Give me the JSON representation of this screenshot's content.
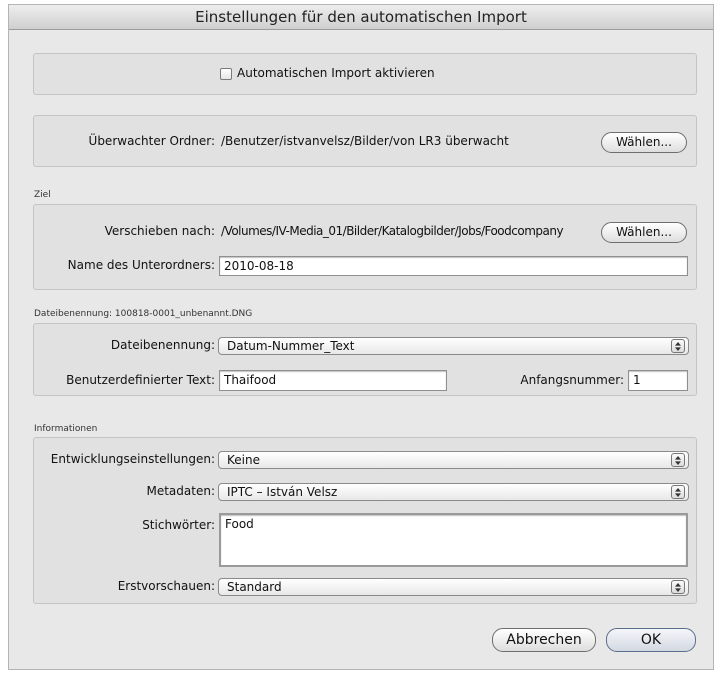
{
  "window": {
    "title": "Einstellungen für den automatischen Import"
  },
  "auto_import": {
    "label": "Automatischen Import aktivieren",
    "checked": false
  },
  "watched": {
    "label": "Überwachter Ordner:",
    "path": "/Benutzer/istvanvelsz/Bilder/von LR3 überwacht",
    "button": "Wählen..."
  },
  "destination": {
    "section": "Ziel",
    "move_label": "Verschieben nach:",
    "move_path": "/Volumes/IV-Media_01/Bilder/Katalogbilder/Jobs/Foodcompany",
    "button": "Wählen...",
    "subfolder_label": "Name des Unterordners:",
    "subfolder_value": "2010-08-18"
  },
  "naming": {
    "section": "Dateibenennung: 100818-0001_unbenannt.DNG",
    "label": "Dateibenennung:",
    "value": "Datum-Nummer_Text",
    "custom_label": "Benutzerdefinierter Text:",
    "custom_value": "Thaifood",
    "start_label": "Anfangsnummer:",
    "start_value": "1"
  },
  "info": {
    "section": "Informationen",
    "develop_label": "Entwicklungseinstellungen:",
    "develop_value": "Keine",
    "meta_label": "Metadaten:",
    "meta_value": "IPTC – István Velsz",
    "keywords_label": "Stichwörter:",
    "keywords_value": "Food",
    "preview_label": "Erstvorschauen:",
    "preview_value": "Standard"
  },
  "footer": {
    "cancel": "Abbrechen",
    "ok": "OK"
  }
}
